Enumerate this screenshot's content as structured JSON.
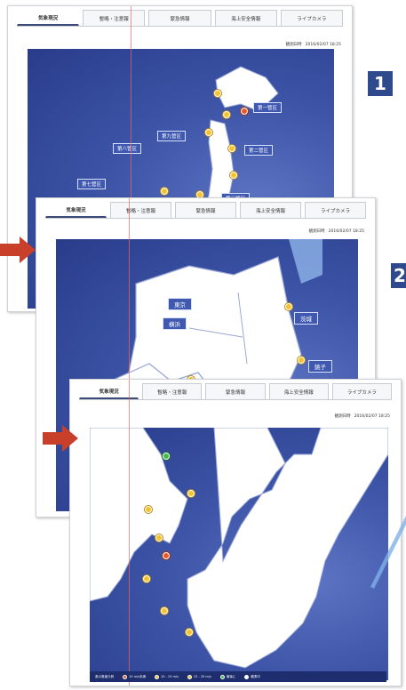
{
  "tabs": [
    "気象現況",
    "暫略・注意報",
    "緊急情報",
    "海上安全情報",
    "ライブカメラ"
  ],
  "step_numbers": [
    "1",
    "2"
  ],
  "timestamps": {
    "p1": {
      "label": "観測日時",
      "value": "2016/02/07 18:25"
    },
    "p2": {
      "label": "観測日時",
      "value": "2016/02/07 18:25"
    },
    "p3": {
      "label": "観測日時",
      "value": "2016/02/07 18:25"
    }
  },
  "panel1_regions": [
    "第一管区",
    "第九管区",
    "第八管区",
    "第二管区",
    "第七管区",
    "第三管区"
  ],
  "panel2_regions": [
    "東京",
    "横浜",
    "茨城",
    "銚子"
  ],
  "panel3_legend": {
    "title": "風の風速凡例",
    "items": [
      "10 m/s未満",
      "10 - 15 m/s",
      "15 - 20 m/s",
      "最後に",
      "観測中"
    ]
  },
  "colors": {
    "accent": "#2f4a8c",
    "arrow": "#c8402a",
    "map": "#3e55a8",
    "pin": "#f2c230"
  }
}
